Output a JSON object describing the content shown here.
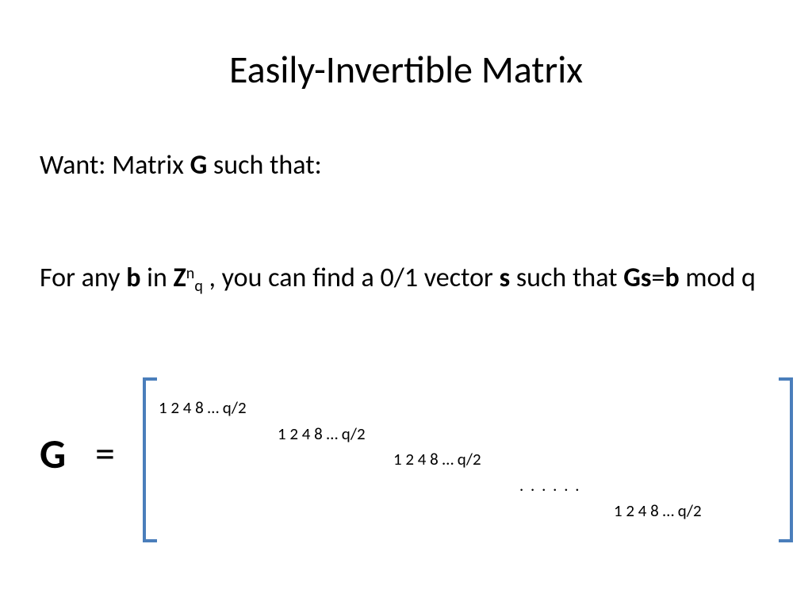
{
  "title": "Easily-Invertible Matrix",
  "line1": {
    "prefix": "Want: Matrix ",
    "G": "G",
    "suffix": " such that:"
  },
  "line2": {
    "p1": "For any ",
    "b": "b",
    "p2": " in ",
    "Z": "Z",
    "sup": "n",
    "sub": "q",
    "p3": " , you can find a 0/1 vector ",
    "s": "s",
    "p4": " such that ",
    "Gs": "Gs",
    "eq": "=",
    "b2": "b",
    "p5": " mod q"
  },
  "G_label": "G",
  "equals": "=",
  "matrix": {
    "row1": "1 2 4 8 … q/2",
    "row2": "1 2 4 8 … q/2",
    "row3": "1 2 4 8 … q/2",
    "row4": ". . . . . .",
    "row5": "1 2 4 8 … q/2"
  }
}
